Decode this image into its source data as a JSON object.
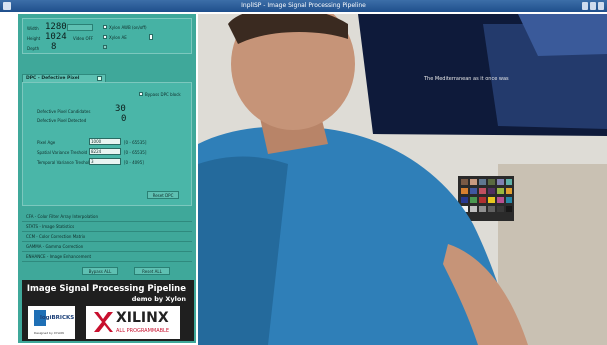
{
  "window": {
    "title": "InplISP - Image Signal Processing Pipeline"
  },
  "resolution": {
    "width_label": "Width",
    "width_value": "1280",
    "height_label": "Height",
    "height_value": "1024",
    "depth_label": "Depth",
    "depth_value": "8",
    "video_off_label": "Video OFF",
    "checkbox_awb_label": "Xylon AWB (on/off)",
    "checkbox_ae_label": "Xylon AE"
  },
  "dpc": {
    "tab_label": "DPC - Defective Pixel Correction",
    "bypass_label": "Bypass DPC block",
    "candidates_label": "Defective Pixel Candidates",
    "candidates_value": "30",
    "detected_label": "Defective Pixel Detected",
    "detected_value": "0",
    "pixel_age_label": "Pixel Age",
    "pixel_age_value": "1000",
    "pixel_age_range": "[0 - 65535]",
    "spatial_label": "Spatial Variance Treshold",
    "spatial_value": "8224",
    "spatial_range": "[0 - 65535]",
    "temporal_label": "Temporal Variance Treshold",
    "temporal_value": "3",
    "temporal_range": "[0 - 4095]",
    "reset_label": "Reset DPC"
  },
  "sections": [
    "CFA - Color Filter Array Interpolation",
    "STATS - Image Statistics",
    "CCM - Color Correction Matrix",
    "GAMMA - Gamma Correction",
    "ENHANCE - Image Enhancement"
  ],
  "buttons": {
    "bypass_all": "Bypass ALL",
    "reset_all": "Reset ALL"
  },
  "banner": {
    "title": "Image Signal Processing Pipeline",
    "subtitle": "demo by Xylon",
    "logo1_text": "logiBRICKS",
    "logo1_sub": "Designed by XYLON",
    "logo2_text": "XILINX",
    "logo2_sub": "ALL PROGRAMMABLE"
  },
  "poster_text": "The Mediterranean as it once was"
}
